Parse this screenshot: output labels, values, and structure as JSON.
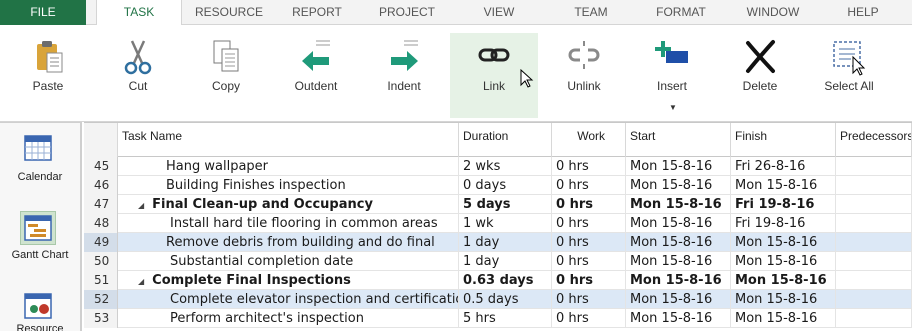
{
  "tabs": [
    {
      "label": "FILE"
    },
    {
      "label": "TASK"
    },
    {
      "label": "RESOURCE"
    },
    {
      "label": "REPORT"
    },
    {
      "label": "PROJECT"
    },
    {
      "label": "VIEW"
    },
    {
      "label": "TEAM"
    },
    {
      "label": "FORMAT"
    },
    {
      "label": "WINDOW"
    },
    {
      "label": "HELP"
    }
  ],
  "ribbon": {
    "paste": "Paste",
    "cut": "Cut",
    "copy": "Copy",
    "outdent": "Outdent",
    "indent": "Indent",
    "link": "Link",
    "unlink": "Unlink",
    "insert": "Insert",
    "delete": "Delete",
    "select_all": "Select All"
  },
  "views": {
    "calendar": "Calendar",
    "gantt": "Gantt Chart",
    "resource": "Resource"
  },
  "columns": {
    "task_name": "Task Name",
    "duration": "Duration",
    "work": "Work",
    "start": "Start",
    "finish": "Finish",
    "predecessors": "Predecessors"
  },
  "rows": [
    {
      "id": "45",
      "name": "Hang wallpaper",
      "duration": "2 wks",
      "work": "0 hrs",
      "start": "Mon 15-8-16",
      "finish": "Fri 26-8-16",
      "summary": false,
      "selected": false
    },
    {
      "id": "46",
      "name": "Building Finishes inspection",
      "duration": "0 days",
      "work": "0 hrs",
      "start": "Mon 15-8-16",
      "finish": "Mon 15-8-16",
      "summary": false,
      "selected": false
    },
    {
      "id": "47",
      "name": "Final Clean-up and Occupancy",
      "duration": "5 days",
      "work": "0 hrs",
      "start": "Mon 15-8-16",
      "finish": "Fri 19-8-16",
      "summary": true,
      "selected": false
    },
    {
      "id": "48",
      "name": "Install hard tile flooring in common areas",
      "duration": "1 wk",
      "work": "0 hrs",
      "start": "Mon 15-8-16",
      "finish": "Fri 19-8-16",
      "summary": false,
      "selected": false
    },
    {
      "id": "49",
      "name": "Remove debris from building and do final",
      "duration": "1 day",
      "work": "0 hrs",
      "start": "Mon 15-8-16",
      "finish": "Mon 15-8-16",
      "summary": false,
      "selected": true
    },
    {
      "id": "50",
      "name": "Substantial completion date",
      "duration": "1 day",
      "work": "0 hrs",
      "start": "Mon 15-8-16",
      "finish": "Mon 15-8-16",
      "summary": false,
      "selected": false
    },
    {
      "id": "51",
      "name": "Complete Final Inspections",
      "duration": "0.63 days",
      "work": "0 hrs",
      "start": "Mon 15-8-16",
      "finish": "Mon 15-8-16",
      "summary": true,
      "selected": false
    },
    {
      "id": "52",
      "name": "Complete elevator inspection and certification",
      "duration": "0.5 days",
      "work": "0 hrs",
      "start": "Mon 15-8-16",
      "finish": "Mon 15-8-16",
      "summary": false,
      "selected": true
    },
    {
      "id": "53",
      "name": "Perform architect's inspection",
      "duration": "5 hrs",
      "work": "0 hrs",
      "start": "Mon 15-8-16",
      "finish": "Mon 15-8-16",
      "summary": false,
      "selected": false
    }
  ],
  "colors": {
    "accent": "#217346",
    "selection": "#dce8f6",
    "arrow_green": "#1f9a7a"
  }
}
